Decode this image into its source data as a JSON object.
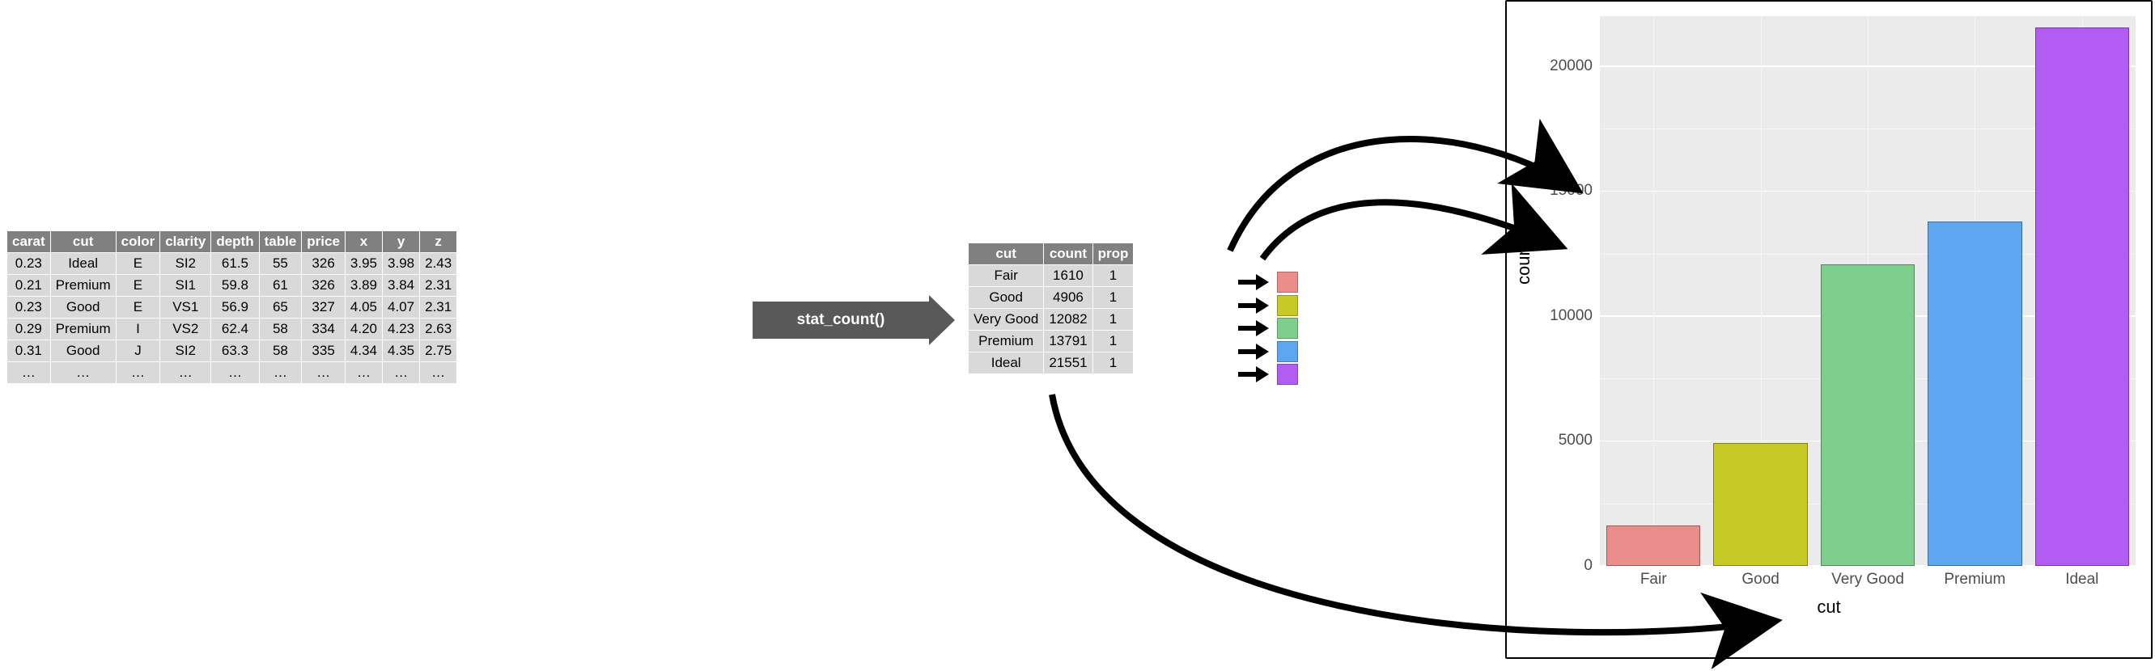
{
  "raw_table": {
    "headers": [
      "carat",
      "cut",
      "color",
      "clarity",
      "depth",
      "table",
      "price",
      "x",
      "y",
      "z"
    ],
    "rows": [
      [
        "0.23",
        "Ideal",
        "E",
        "SI2",
        "61.5",
        "55",
        "326",
        "3.95",
        "3.98",
        "2.43"
      ],
      [
        "0.21",
        "Premium",
        "E",
        "SI1",
        "59.8",
        "61",
        "326",
        "3.89",
        "3.84",
        "2.31"
      ],
      [
        "0.23",
        "Good",
        "E",
        "VS1",
        "56.9",
        "65",
        "327",
        "4.05",
        "4.07",
        "2.31"
      ],
      [
        "0.29",
        "Premium",
        "I",
        "VS2",
        "62.4",
        "58",
        "334",
        "4.20",
        "4.23",
        "2.63"
      ],
      [
        "0.31",
        "Good",
        "J",
        "SI2",
        "63.3",
        "58",
        "335",
        "4.34",
        "4.35",
        "2.75"
      ],
      [
        "…",
        "…",
        "…",
        "…",
        "…",
        "…",
        "…",
        "…",
        "…",
        "…"
      ]
    ]
  },
  "fn_label": "stat_count()",
  "agg_table": {
    "headers": [
      "cut",
      "count",
      "prop"
    ],
    "rows": [
      [
        "Fair",
        "1610",
        "1"
      ],
      [
        "Good",
        "4906",
        "1"
      ],
      [
        "Very Good",
        "12082",
        "1"
      ],
      [
        "Premium",
        "13791",
        "1"
      ],
      [
        "Ideal",
        "21551",
        "1"
      ]
    ]
  },
  "swatch_colors": [
    "#eb8d8b",
    "#c7c927",
    "#7ecf8e",
    "#5ea6ef",
    "#b25cf4"
  ],
  "chart_data": {
    "type": "bar",
    "categories": [
      "Fair",
      "Good",
      "Very Good",
      "Premium",
      "Ideal"
    ],
    "values": [
      1610,
      4906,
      12082,
      13791,
      21551
    ],
    "colors": [
      "#eb8d8b",
      "#c7c927",
      "#7ecf8e",
      "#5ea6ef",
      "#b25cf4"
    ],
    "xlabel": "cut",
    "ylabel": "count",
    "ylim": [
      0,
      22000
    ],
    "yticks": [
      0,
      5000,
      10000,
      15000,
      20000
    ],
    "title": ""
  }
}
